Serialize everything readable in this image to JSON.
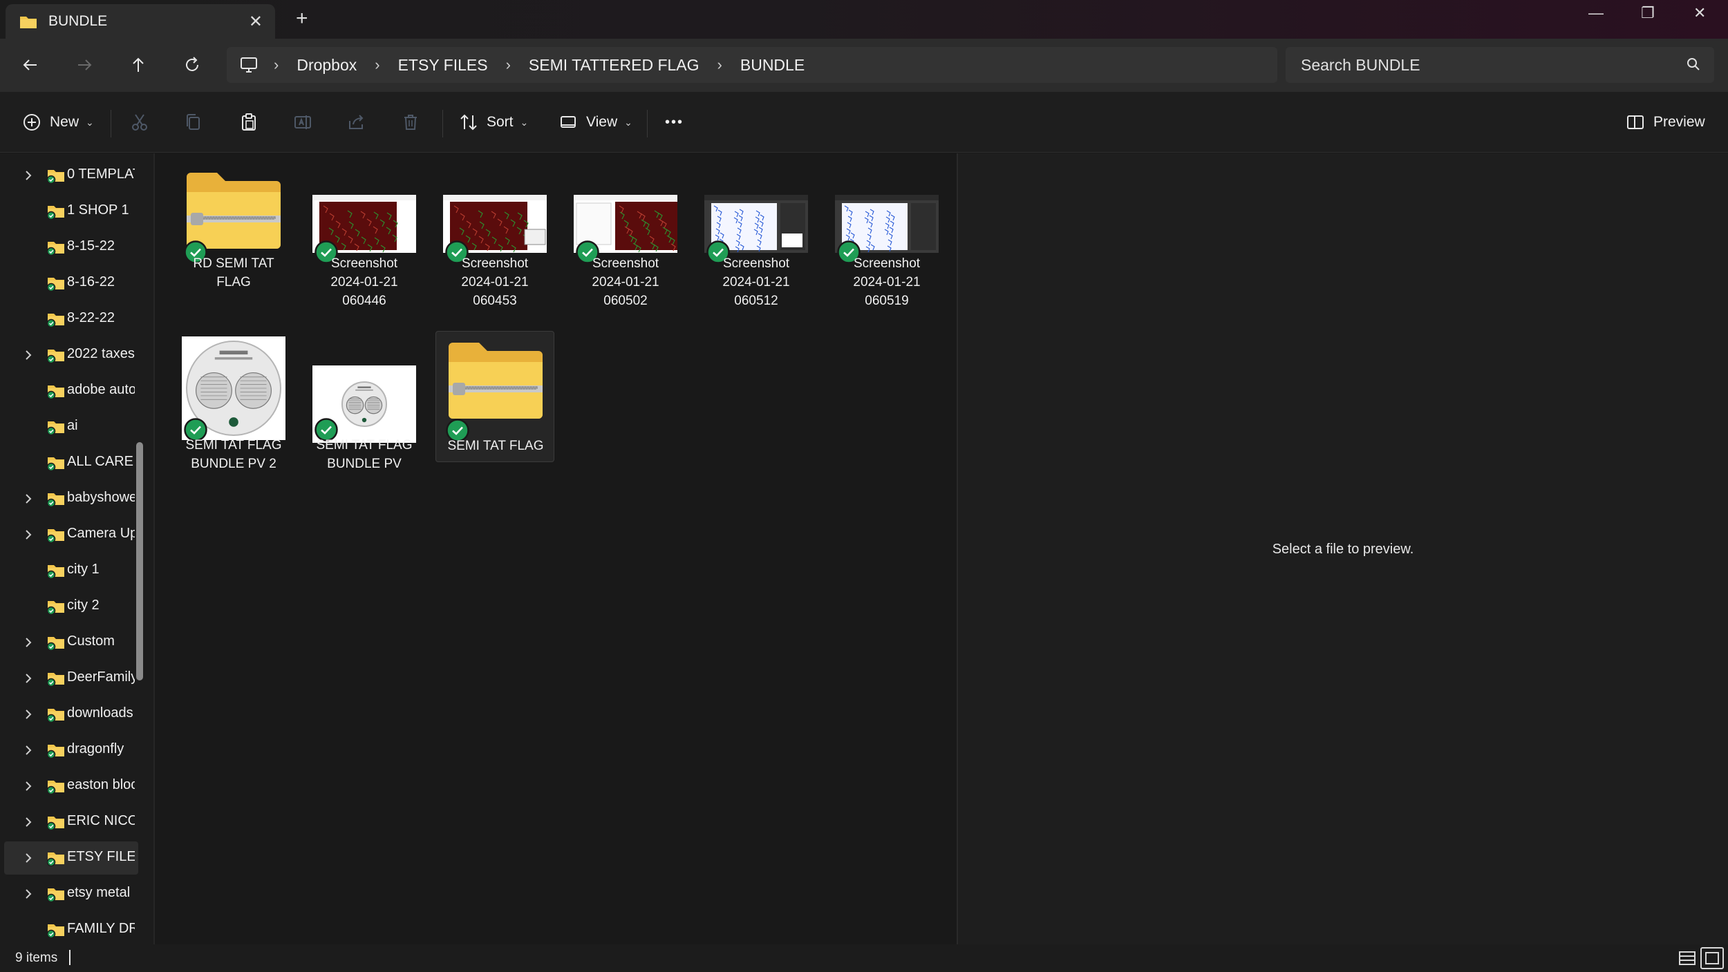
{
  "tab": {
    "title": "BUNDLE",
    "close_glyph": "✕",
    "new_tab_glyph": "+"
  },
  "window_controls": {
    "minimize": "—",
    "restore": "❐",
    "close": "✕"
  },
  "address": {
    "breadcrumbs": [
      "Dropbox",
      "ETSY FILES",
      "SEMI TATTERED FLAG",
      "BUNDLE"
    ],
    "separator": "›"
  },
  "search": {
    "placeholder": "Search BUNDLE"
  },
  "toolbar": {
    "new_label": "New",
    "sort_label": "Sort",
    "view_label": "View",
    "more_label": "•••",
    "preview_label": "Preview"
  },
  "sidebar": {
    "items": [
      {
        "label": "0 TEMPLAT",
        "expandable": true
      },
      {
        "label": "1 SHOP 1",
        "expandable": false
      },
      {
        "label": "8-15-22",
        "expandable": false
      },
      {
        "label": "8-16-22",
        "expandable": false
      },
      {
        "label": "8-22-22",
        "expandable": false
      },
      {
        "label": "2022 taxes",
        "expandable": true
      },
      {
        "label": "adobe auto",
        "expandable": false
      },
      {
        "label": "ai",
        "expandable": false
      },
      {
        "label": "ALL CARE",
        "expandable": false
      },
      {
        "label": "babyshowe",
        "expandable": true
      },
      {
        "label": "Camera Up",
        "expandable": true
      },
      {
        "label": "city 1",
        "expandable": false
      },
      {
        "label": "city 2",
        "expandable": false
      },
      {
        "label": "Custom",
        "expandable": true
      },
      {
        "label": "DeerFamily",
        "expandable": true
      },
      {
        "label": "downloads",
        "expandable": true
      },
      {
        "label": "dragonfly",
        "expandable": true
      },
      {
        "label": "easton bloc",
        "expandable": true
      },
      {
        "label": "ERIC NICOI",
        "expandable": true
      },
      {
        "label": "ETSY FILES",
        "expandable": true,
        "selected": true
      },
      {
        "label": "etsy metal",
        "expandable": true
      },
      {
        "label": "FAMILY DR",
        "expandable": false
      }
    ]
  },
  "files": [
    {
      "kind": "zip-folder",
      "name_lines": [
        "RD SEMI TAT",
        "FLAG"
      ]
    },
    {
      "kind": "screenshot-red",
      "name_lines": [
        "Screenshot",
        "2024-01-21",
        "060446"
      ]
    },
    {
      "kind": "screenshot-red",
      "name_lines": [
        "Screenshot",
        "2024-01-21",
        "060453"
      ]
    },
    {
      "kind": "screenshot-red",
      "name_lines": [
        "Screenshot",
        "2024-01-21",
        "060502"
      ]
    },
    {
      "kind": "screenshot-blue",
      "name_lines": [
        "Screenshot",
        "2024-01-21",
        "060512"
      ]
    },
    {
      "kind": "screenshot-blue",
      "name_lines": [
        "Screenshot",
        "2024-01-21",
        "060519"
      ]
    },
    {
      "kind": "sign-preview",
      "name_lines": [
        "SEMI TAT FLAG",
        "BUNDLE PV 2"
      ]
    },
    {
      "kind": "sign-preview-small",
      "name_lines": [
        "SEMI TAT FLAG",
        "BUNDLE PV"
      ]
    },
    {
      "kind": "zip-folder",
      "name_lines": [
        "SEMI TAT FLAG"
      ],
      "selected": true
    }
  ],
  "preview_pane": {
    "message": "Select a file to preview."
  },
  "status": {
    "item_count": "9 items"
  },
  "colors": {
    "sync_green": "#1f9d55",
    "folder_yellow": "#f3c64b",
    "accent": "#60cdff"
  }
}
